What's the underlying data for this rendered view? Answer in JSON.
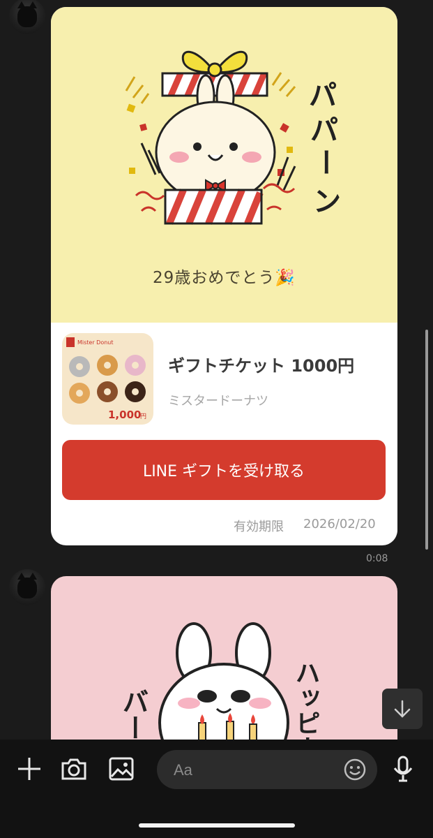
{
  "gift_card": {
    "message": "29歳おめでとう🎉",
    "hero_sticker_text": "パパーン",
    "product": {
      "name": "ギフトチケット 1000円",
      "brand": "ミスタードーナツ",
      "thumb_logo": "Mister Donut",
      "thumb_price": "1,000",
      "thumb_price_unit": "円"
    },
    "receive_button_label": "LINE ギフトを受け取る",
    "expiry_label": "有効期限",
    "expiry_date": "2026/02/20"
  },
  "message_timestamp": "0:08",
  "sticker": {
    "text_left": "バースデ",
    "text_right": "ハッピー"
  },
  "input_bar": {
    "placeholder": "Aa",
    "icons": [
      "plus-icon",
      "camera-icon",
      "image-icon",
      "emoji-icon",
      "microphone-icon"
    ]
  },
  "colors": {
    "background": "#1b1b1b",
    "gift_hero_bg": "#f7efae",
    "receive_button": "#d43b2d",
    "sticker_bg": "#f4cdd1"
  }
}
